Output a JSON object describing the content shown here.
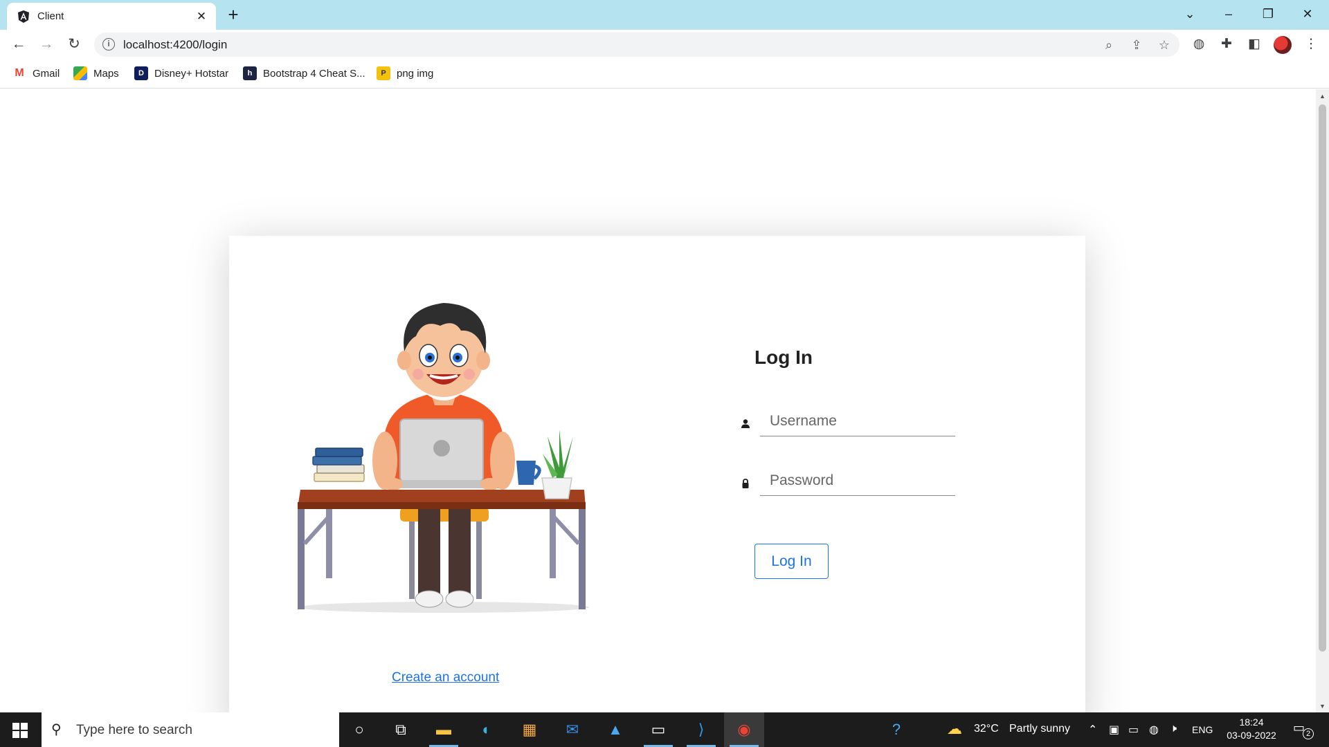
{
  "browser": {
    "tab": {
      "title": "Client",
      "favicon": "angular-icon"
    },
    "address_bar": {
      "url": "localhost:4200/login"
    },
    "bookmarks": [
      {
        "label": "Gmail",
        "icon": "gmail-icon"
      },
      {
        "label": "Maps",
        "icon": "maps-icon"
      },
      {
        "label": "Disney+ Hotstar",
        "icon": "hotstar-icon"
      },
      {
        "label": "Bootstrap 4 Cheat S...",
        "icon": "bootstrap-icon"
      },
      {
        "label": "png img",
        "icon": "png-icon"
      }
    ]
  },
  "page": {
    "login": {
      "title": "Log In",
      "username": {
        "placeholder": "Username",
        "value": ""
      },
      "password": {
        "placeholder": "Password",
        "value": ""
      },
      "submit_label": "Log In"
    },
    "create_account_link": "Create an account",
    "illustration": "boy-at-desk-with-laptop-illustration"
  },
  "taskbar": {
    "search_placeholder": "Type here to search",
    "weather": {
      "temp": "32°C",
      "condition": "Partly sunny"
    },
    "language": "ENG",
    "time": "18:24",
    "date": "03-09-2022",
    "notification_count": "2"
  },
  "colors": {
    "titlebar": "#b6e3f0",
    "link": "#1a73e8",
    "taskbar": "#1c1c1c"
  }
}
